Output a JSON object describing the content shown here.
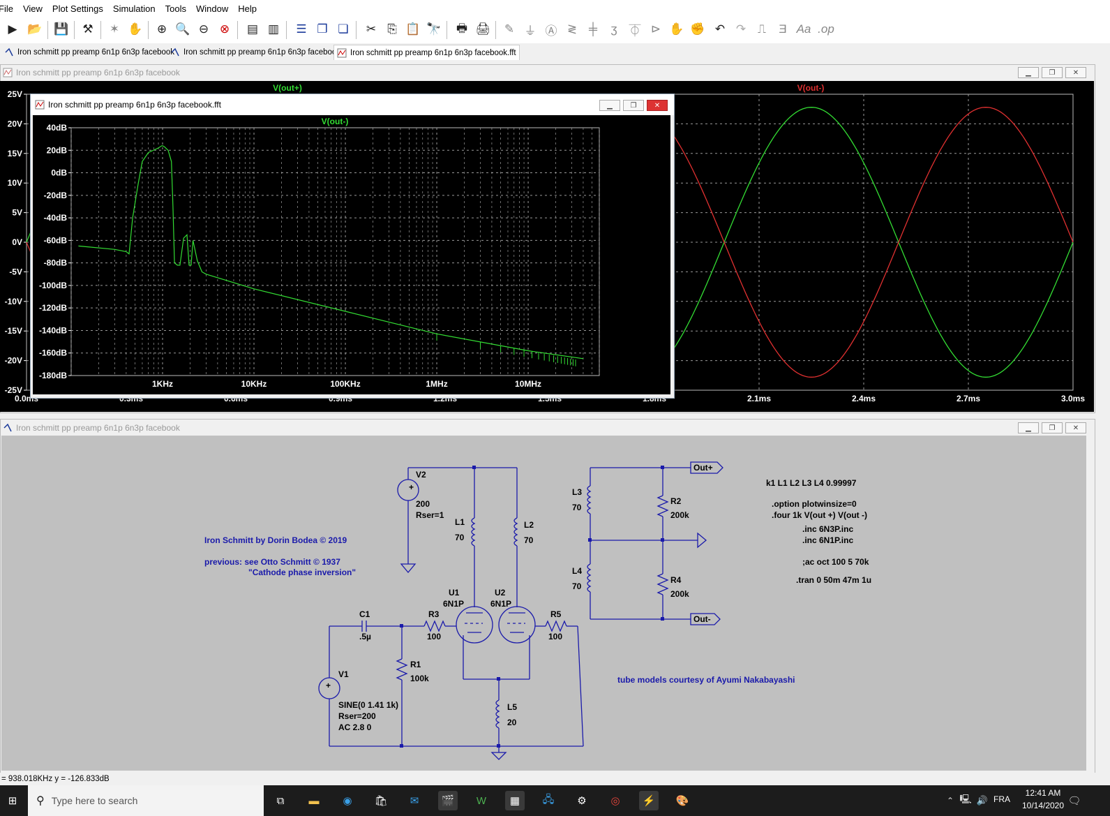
{
  "menu": [
    "File",
    "View",
    "Plot Settings",
    "Simulation",
    "Tools",
    "Window",
    "Help"
  ],
  "tabs": [
    {
      "label": "Iron schmitt pp preamp 6n1p 6n3p facebook",
      "active": false
    },
    {
      "label": "Iron schmitt pp preamp 6n1p 6n3p facebook",
      "active": false
    },
    {
      "label": "Iron schmitt pp preamp 6n1p 6n3p facebook.fft",
      "active": true
    }
  ],
  "plot_window": {
    "title": "Iron schmitt pp preamp 6n1p 6n3p facebook"
  },
  "fft_window": {
    "title": "Iron schmitt pp preamp 6n1p 6n3p facebook.fft"
  },
  "schematic_window": {
    "title": "Iron schmitt pp preamp 6n1p 6n3p facebook"
  },
  "status": {
    "text": "= 938.018KHz   y = -126.833dB"
  },
  "taskbar": {
    "search_placeholder": "Type here to search",
    "language": "FRA",
    "time": "12:41 AM",
    "date": "10/14/2020"
  },
  "colors": {
    "trace_green": "#33dd33",
    "trace_red": "#e03030",
    "schematic_wire": "#1a1aaa",
    "plot_bg": "#000000",
    "grid": "#9a9a9a"
  },
  "chart_data": [
    {
      "type": "line",
      "title": "",
      "series": [
        {
          "name": "V(out+)",
          "color": "#33dd33",
          "wave": "sine",
          "amplitude": 22.8,
          "frequency_khz": 1,
          "phase_deg": 0
        },
        {
          "name": "V(out-)",
          "color": "#e03030",
          "wave": "sine",
          "amplitude": 22.8,
          "frequency_khz": 1,
          "phase_deg": 180
        }
      ],
      "xlabel": "",
      "ylabel": "",
      "xlim": [
        0,
        3
      ],
      "ylim": [
        -25,
        25
      ],
      "x_ticks": [
        "0.0ms",
        "0.3ms",
        "0.6ms",
        "0.9ms",
        "1.2ms",
        "1.5ms",
        "1.8ms",
        "2.1ms",
        "2.4ms",
        "2.7ms",
        "3.0ms"
      ],
      "y_ticks": [
        "25V",
        "20V",
        "15V",
        "10V",
        "5V",
        "0V",
        "-5V",
        "-10V",
        "-15V",
        "-20V",
        "-25V"
      ],
      "grid": true
    },
    {
      "type": "line",
      "title": "",
      "series": [
        {
          "name": "V(out-)",
          "color": "#33dd33",
          "x_hz": [
            120,
            300,
            400,
            430,
            470,
            540,
            600,
            700,
            900,
            980,
            1000,
            1050,
            1150,
            1250,
            1300,
            1350,
            1450,
            1550,
            1700,
            1850,
            1950,
            2050,
            2150,
            2400,
            2700,
            3000,
            10000,
            100000,
            1000000,
            10000000,
            40000000
          ],
          "y_db": [
            -65,
            -68,
            -70,
            -72,
            -40,
            -10,
            10,
            18,
            22,
            24,
            24,
            23,
            20,
            10,
            -30,
            -80,
            -82,
            -82,
            -58,
            -55,
            -82,
            -82,
            -60,
            -78,
            -88,
            -90,
            -103,
            -123,
            -143,
            -158,
            -165
          ]
        }
      ],
      "xlabel": "",
      "ylabel": "",
      "x_ticks": [
        "1KHz",
        "10KHz",
        "100KHz",
        "1MHz",
        "10MHz"
      ],
      "y_ticks": [
        "40dB",
        "20dB",
        "0dB",
        "-20dB",
        "-40dB",
        "-60dB",
        "-80dB",
        "-100dB",
        "-120dB",
        "-140dB",
        "-160dB",
        "-180dB"
      ],
      "ylim": [
        -180,
        40
      ],
      "xscale": "log",
      "grid": true
    }
  ],
  "schematic": {
    "title_note": "Iron Schmitt by Dorin Bodea © 2019",
    "previous_note": "previous: see Otto Schmitt © 1937",
    "cathode_note": "\"Cathode phase inversion\"",
    "credits": "tube models courtesy of Ayumi Nakabayashi",
    "directives": [
      "k1 L1 L2 L3 L4 0.99997",
      ".option plotwinsize=0",
      ".four 1k V(out +) V(out -)",
      ".inc 6N3P.inc",
      ".inc 6N1P.inc",
      ";ac oct 100 5 70k",
      ".tran 0 50m 47m 1u"
    ],
    "labels": {
      "V2": "V2",
      "V2_val": "200",
      "V2_rser": "Rser=1",
      "L1": "L1",
      "L1_val": "70",
      "L2": "L2",
      "L2_val": "70",
      "L3": "L3",
      "L3_val": "70",
      "L4": "L4",
      "L4_val": "70",
      "R2": "R2",
      "R2_val": "200k",
      "R4": "R4",
      "R4_val": "200k",
      "out_plus": "Out+",
      "out_minus": "Out-",
      "U1": "U1",
      "U1_model": "6N1P",
      "U2": "U2",
      "U2_model": "6N1P",
      "C1": "C1",
      "C1_val": ".5µ",
      "R3": "R3",
      "R3_val": "100",
      "R5": "R5",
      "R5_val": "100",
      "R1": "R1",
      "R1_val": "100k",
      "V1": "V1",
      "V1_sine": "SINE(0 1.41 1k)",
      "V1_rser": "Rser=200",
      "V1_ac": "AC 2.8 0",
      "L5": "L5",
      "L5_val": "20"
    }
  }
}
